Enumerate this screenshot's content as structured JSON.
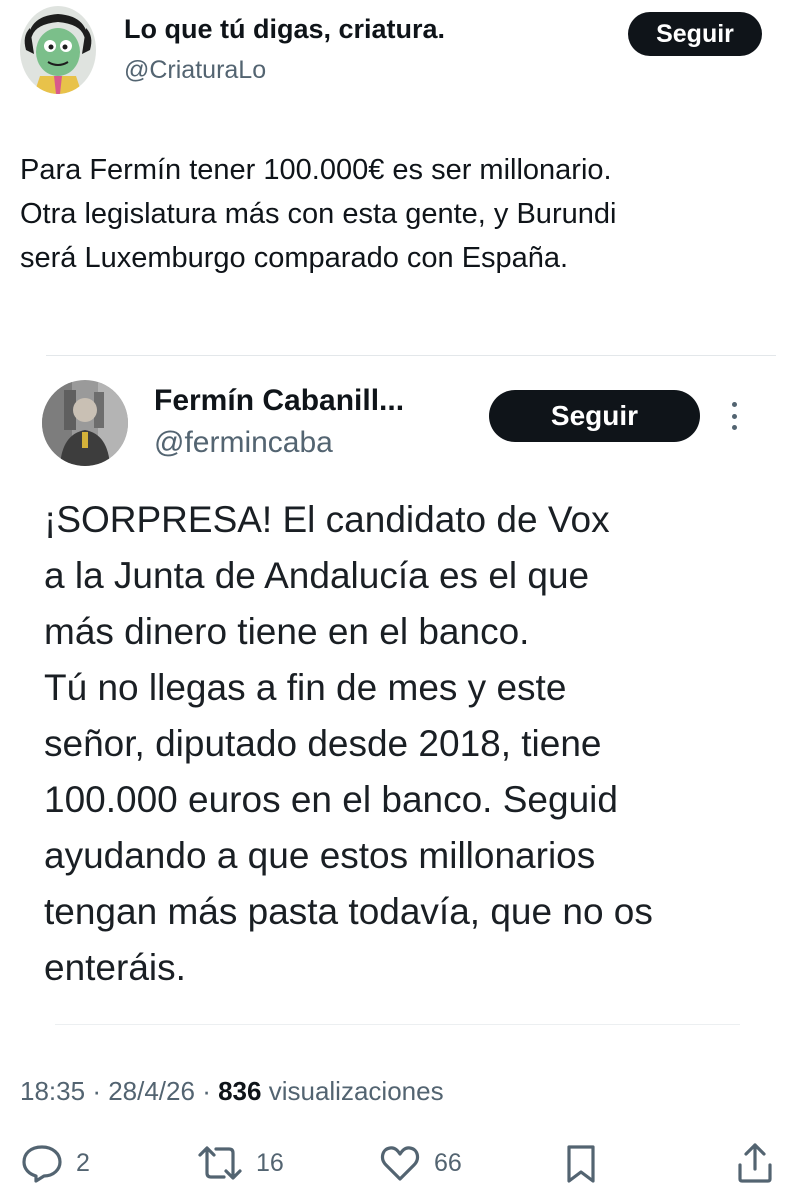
{
  "author": {
    "name": "Lo que tú digas, criatura.",
    "handle": "@CriaturaLo",
    "avatar_icon": "cartoon-character-avatar"
  },
  "follow_label": "Seguir",
  "post": {
    "lines": [
      "Para Fermín tener 100.000€ es ser millonario.",
      "Otra legislatura más con esta gente, y Burundi",
      "será Luxemburgo comparado con España."
    ]
  },
  "quoted": {
    "name": "Fermín Cabanill...",
    "handle": "@fermincaba",
    "follow_label": "Seguir",
    "more_icon": "vertical-ellipsis-icon",
    "lines": [
      "¡SORPRESA! El candidato de Vox",
      "a la Junta de Andalucía es el que",
      "más dinero tiene en el banco.",
      "Tú no llegas a fin de mes y este",
      "señor, diputado desde 2018, tiene",
      "100.000 euros en el banco. Seguid",
      "ayudando a que estos millonarios",
      "tengan más pasta todavía, que no os",
      "enteráis."
    ]
  },
  "meta": {
    "time": "18:35",
    "date": "28/4/26",
    "views_count": "836",
    "views_label": "visualizaciones"
  },
  "actions": {
    "replies": "2",
    "retweets": "16",
    "likes": "66"
  },
  "colors": {
    "text": "#0f1419",
    "secondary": "#536471",
    "button_bg": "#0f1419",
    "button_text": "#ffffff",
    "divider": "#e3e7ea"
  }
}
